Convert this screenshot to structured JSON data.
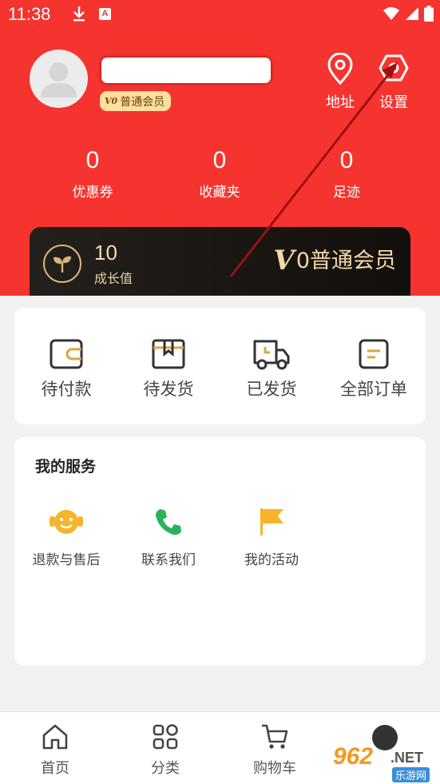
{
  "status_bar": {
    "time": "11:38",
    "icons": [
      "download-icon",
      "a-notification-icon",
      "wifi-icon",
      "signal-icon",
      "battery-icon"
    ]
  },
  "profile": {
    "member_badge": "普通会员",
    "member_badge_prefix": "V0"
  },
  "top_actions": {
    "address_label": "地址",
    "settings_label": "设置"
  },
  "stats": [
    {
      "value": "0",
      "label": "优惠券"
    },
    {
      "value": "0",
      "label": "收藏夹"
    },
    {
      "value": "0",
      "label": "足迹"
    }
  ],
  "growth": {
    "value": "10",
    "label": "成长值",
    "level_v": "V",
    "level_text": "0普通会员"
  },
  "orders": [
    {
      "label": "待付款",
      "icon": "wallet-icon"
    },
    {
      "label": "待发货",
      "icon": "package-icon"
    },
    {
      "label": "已发货",
      "icon": "truck-icon"
    },
    {
      "label": "全部订单",
      "icon": "order-list-icon"
    }
  ],
  "services": {
    "title": "我的服务",
    "items": [
      {
        "label": "退款与售后",
        "icon": "service-face-icon"
      },
      {
        "label": "联系我们",
        "icon": "phone-icon"
      },
      {
        "label": "我的活动",
        "icon": "flag-icon"
      }
    ]
  },
  "bottom_nav": [
    {
      "label": "首页",
      "icon": "home-icon"
    },
    {
      "label": "分类",
      "icon": "category-icon"
    },
    {
      "label": "购物车",
      "icon": "cart-icon"
    }
  ],
  "watermark": {
    "number": "962",
    "suffix": ".NET",
    "site": "乐游网"
  },
  "colors": {
    "primary_red": "#f5342f",
    "gold": "#f4d8a8",
    "dark_card": "#1a1612",
    "order_icon_gold": "#d9a545",
    "phone_green": "#29b35a",
    "flag_orange": "#f7b52c"
  }
}
